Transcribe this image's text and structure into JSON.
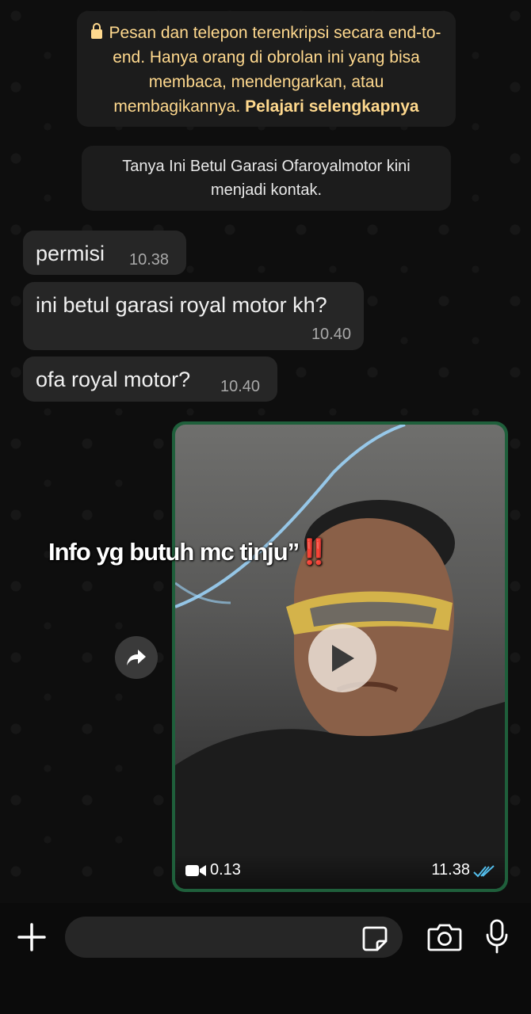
{
  "system": {
    "encryption_notice_text": "Pesan dan telepon terenkripsi secara end-to-end. Hanya orang di obrolan ini yang bisa membaca, mendengarkan, atau membagikannya.",
    "encryption_learn_more": "Pelajari selengkapnya",
    "contact_notice": "Tanya Ini Betul Garasi Ofaroyalmotor kini menjadi kontak."
  },
  "messages": [
    {
      "text": "permisi",
      "time": "10.38"
    },
    {
      "text": "ini betul garasi royal motor kh?",
      "time": "10.40"
    },
    {
      "text": "ofa royal motor?",
      "time": "10.40"
    }
  ],
  "video_message": {
    "duration": "0.13",
    "time": "11.38",
    "status": "read"
  },
  "overlay_caption": {
    "text": "Info yg butuh mc tinju”",
    "emphasis": "‼️"
  },
  "input": {
    "placeholder": ""
  },
  "colors": {
    "outgoing_border": "#1f5f3b",
    "incoming_bubble": "#262626",
    "system_text_yellow": "#ffd98e",
    "read_ticks": "#53bdeb"
  },
  "icons": [
    "lock-icon",
    "forward-icon",
    "play-icon",
    "video-camera-icon",
    "double-check-icon",
    "plus-icon",
    "sticker-icon",
    "camera-icon",
    "mic-icon"
  ]
}
